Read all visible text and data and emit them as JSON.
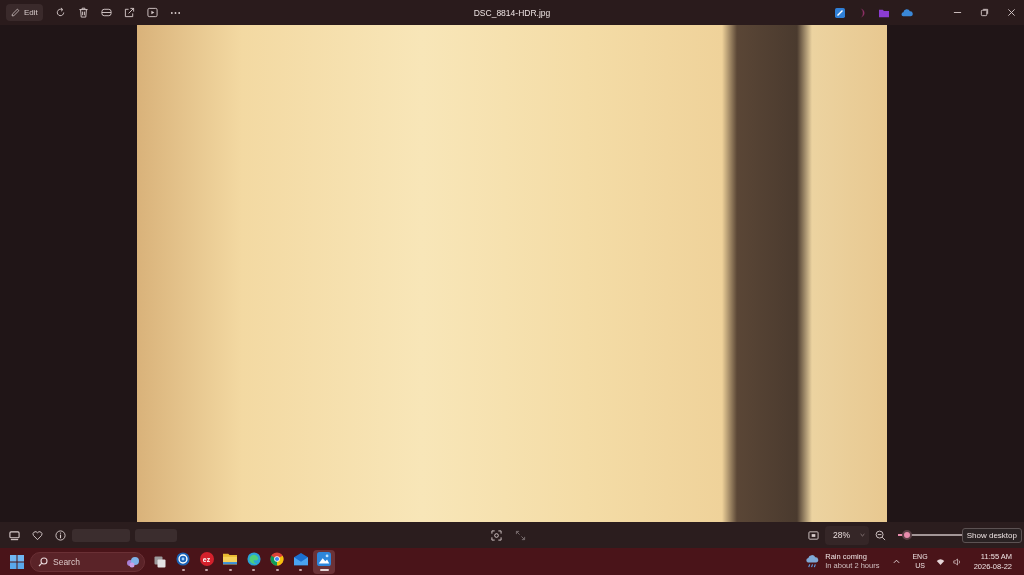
{
  "title_bar": {
    "edit_button": {
      "label": "Edit"
    },
    "title": "DSC_8814-HDR.jpg"
  },
  "bottom_bar": {
    "zoom": {
      "value": "28%",
      "level": 0.07
    },
    "tooltip": "Show desktop"
  },
  "taskbar": {
    "search": {
      "placeholder": "Search"
    },
    "apps": [
      {
        "kind": "lens",
        "selected": false
      },
      {
        "kind": "badge",
        "label": "ez",
        "selected": false
      },
      {
        "kind": "folder",
        "selected": false
      },
      {
        "kind": "swirl",
        "selected": false
      },
      {
        "kind": "browser",
        "selected": false
      },
      {
        "kind": "mail",
        "selected": false
      },
      {
        "kind": "image",
        "selected": true
      }
    ],
    "weather": {
      "title": "Rain coming",
      "subtitle": "In about 2 hours"
    },
    "language": {
      "code": "ENG",
      "region": "US"
    },
    "clock": {
      "time": "11:55 AM",
      "date": "2026-08-22"
    }
  }
}
